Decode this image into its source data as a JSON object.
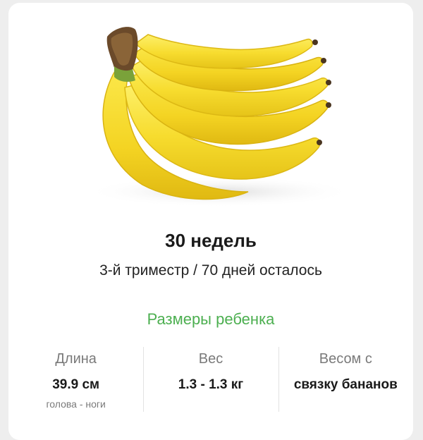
{
  "header": {
    "week_title": "30 недель",
    "subtitle": "3-й триместр / 70 дней осталось"
  },
  "illustration": {
    "icon": "banana-bunch-icon",
    "fruit_color": "#f7dc2e",
    "stem_color": "#6b4a2a"
  },
  "baby_size": {
    "title": "Размеры ребенка",
    "accent_color": "#4caf50",
    "length": {
      "label": "Длина",
      "value": "39.9 см",
      "note": "голова - ноги"
    },
    "weight": {
      "label": "Вес",
      "value": "1.3 - 1.3 кг"
    },
    "comparison": {
      "label": "Весом с",
      "value": "связку бананов"
    }
  }
}
